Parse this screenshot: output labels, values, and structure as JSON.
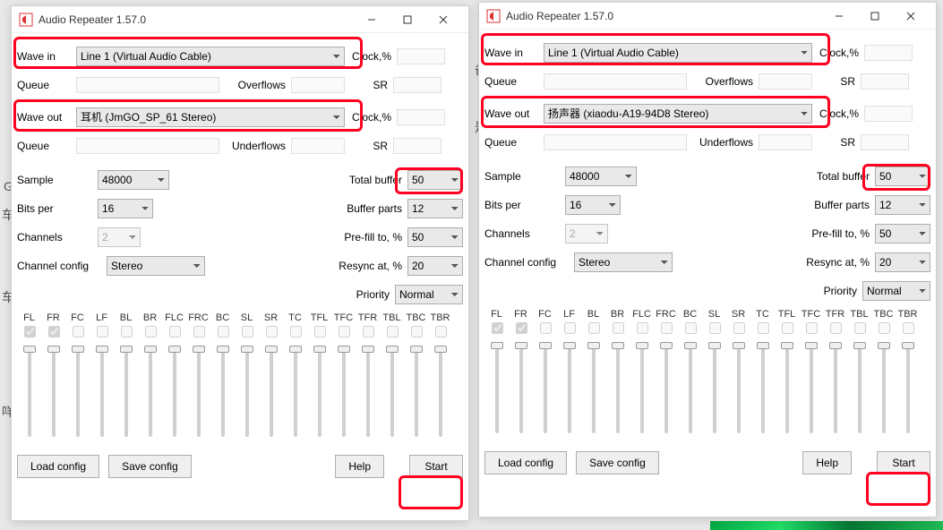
{
  "channels": [
    "FL",
    "FR",
    "FC",
    "LF",
    "BL",
    "BR",
    "FLC",
    "FRC",
    "BC",
    "SL",
    "SR",
    "TC",
    "TFL",
    "TFC",
    "TFR",
    "TBL",
    "TBC",
    "TBR"
  ],
  "checked_channels": [
    "FL",
    "FR"
  ],
  "labels": {
    "wave_in": "Wave in",
    "wave_out": "Wave out",
    "queue": "Queue",
    "overflows": "Overflows",
    "underflows": "Underflows",
    "clock_pct": "Clock,%",
    "sr": "SR",
    "sample": "Sample",
    "bits_per": "Bits per",
    "channels": "Channels",
    "channel_config": "Channel config",
    "total_buffer": "Total buffer",
    "buffer_parts": "Buffer parts",
    "prefill": "Pre-fill to, %",
    "resync": "Resync at, %",
    "priority": "Priority",
    "load_config": "Load config",
    "save_config": "Save config",
    "help": "Help",
    "start": "Start"
  },
  "windows": [
    {
      "title": "Audio Repeater 1.57.0",
      "wave_in": "Line 1 (Virtual Audio Cable)",
      "wave_out": "耳机 (JmGO_SP_61 Stereo)",
      "sample": "48000",
      "bits_per": "16",
      "channels_n": "2",
      "channel_config": "Stereo",
      "total_buffer": "50",
      "buffer_parts": "12",
      "prefill": "50",
      "resync": "20",
      "priority": "Normal",
      "highlight_wave_out": true
    },
    {
      "title": "Audio Repeater 1.57.0",
      "wave_in": "Line 1 (Virtual Audio Cable)",
      "wave_out": "扬声器 (xiaodu-A19-94D8 Stereo)",
      "sample": "48000",
      "bits_per": "16",
      "channels_n": "2",
      "channel_config": "Stereo",
      "total_buffer": "50",
      "buffer_parts": "12",
      "prefill": "50",
      "resync": "20",
      "priority": "Normal",
      "highlight_wave_out": true
    }
  ]
}
